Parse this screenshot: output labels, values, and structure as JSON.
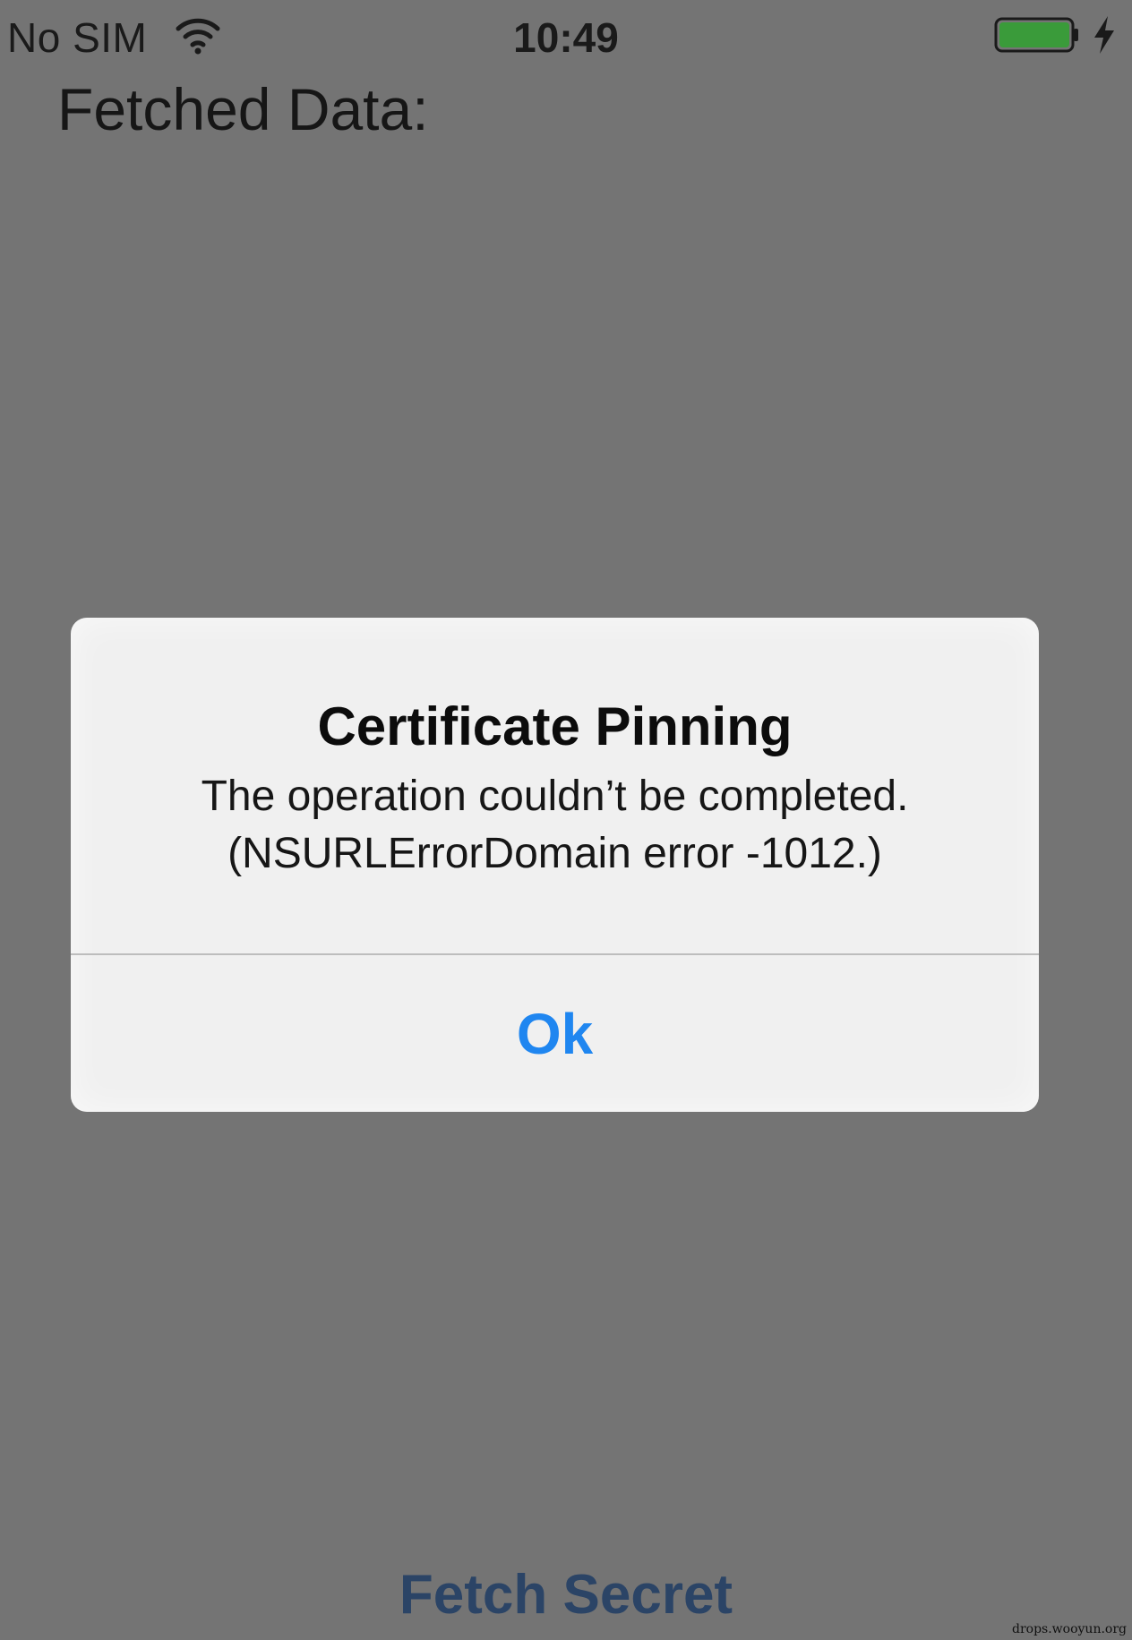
{
  "status_bar": {
    "carrier": "No SIM",
    "time": "10:49",
    "wifi_icon": "wifi-icon",
    "battery_icon": "battery-icon",
    "battery_color": "#3a9b3a",
    "charging_icon": "charging-bolt-icon"
  },
  "main": {
    "fetched_label": "Fetched Data:",
    "fetch_button_label": "Fetch Secret",
    "fetch_button_color": "#2b4466"
  },
  "alert": {
    "title": "Certificate Pinning",
    "message_line1": "The operation couldn’t be completed.",
    "message_line2": "(NSURLErrorDomain error -1012.)",
    "button_label": "Ok",
    "button_color": "#1f86f0"
  },
  "watermark": "drops.wooyun.org"
}
